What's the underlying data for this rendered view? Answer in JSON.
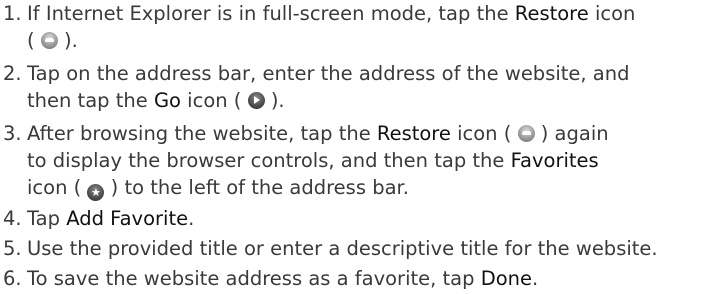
{
  "steps": [
    {
      "number": "1.",
      "lines": [
        {
          "t1": "If Internet Explorer is in full-screen mode, tap the ",
          "k1": "Restore",
          "t2": " icon"
        },
        {
          "t1": "( ",
          "icon": "restore-icon",
          "t2": " )."
        }
      ]
    },
    {
      "number": "2.",
      "lines": [
        {
          "t1": "Tap on the address bar, enter the address of the website, and"
        },
        {
          "t1": "then tap the ",
          "k1": "Go",
          "t2": " icon ( ",
          "icon": "go-icon",
          "t3": " )."
        }
      ]
    },
    {
      "number": "3.",
      "lines": [
        {
          "t1": "After browsing the website, tap the ",
          "k1": "Restore",
          "t2": " icon ( ",
          "icon": "restore-icon",
          "t3": " ) again"
        },
        {
          "t1": "to display the browser controls, and then tap the ",
          "k1": "Favorites"
        },
        {
          "t1": "icon ( ",
          "icon": "favorites-icon",
          "t2": " ) to the left of the address bar."
        }
      ]
    },
    {
      "number": "4.",
      "lines": [
        {
          "t1": "Tap ",
          "k1": "Add Favorite",
          "t2": "."
        }
      ]
    },
    {
      "number": "5.",
      "lines": [
        {
          "t1": "Use the provided title or enter a descriptive title for the website."
        }
      ]
    },
    {
      "number": "6.",
      "lines": [
        {
          "t1": "To save the website address as a favorite, tap ",
          "k1": "Done",
          "t2": "."
        }
      ]
    }
  ],
  "icons": {
    "favorites_glyph": "★"
  }
}
